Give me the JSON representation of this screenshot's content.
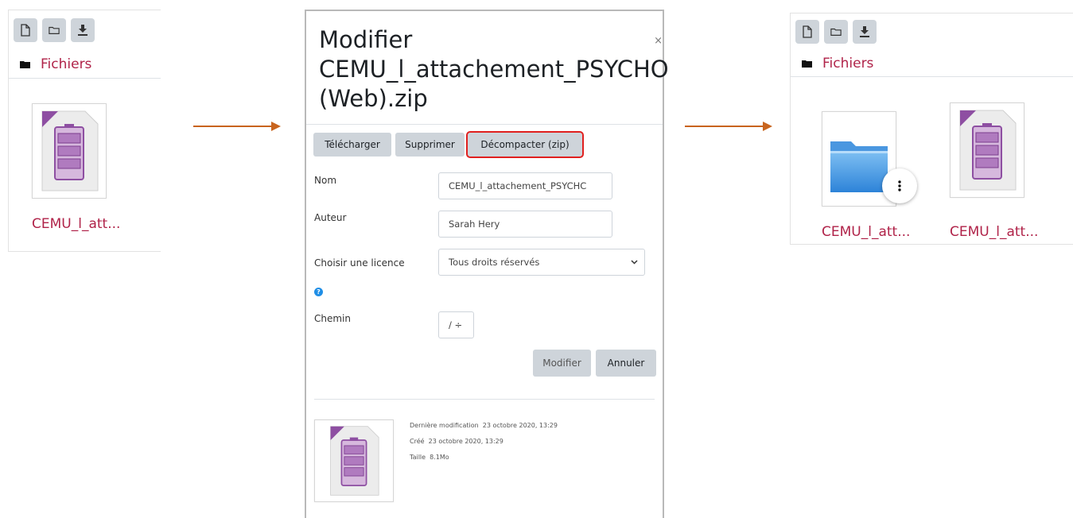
{
  "left_panel": {
    "toolbar": [
      {
        "icon": "new-file-icon"
      },
      {
        "icon": "new-folder-icon"
      },
      {
        "icon": "download-icon"
      }
    ],
    "breadcrumb": "Fichiers",
    "files": [
      {
        "name": "CEMU_l_att...",
        "icon": "zip-archive-icon"
      }
    ]
  },
  "dialog": {
    "title": "Modifier CEMU_l_attachement_PSYCHO (Web).zip",
    "close_glyph": "×",
    "buttons": {
      "download": "Télécharger",
      "delete": "Supprimer",
      "unzip": "Décompacter (zip)",
      "update": "Modifier",
      "cancel": "Annuler"
    },
    "fields": {
      "name_label": "Nom",
      "name_value": "CEMU_l_attachement_PSYCHC",
      "author_label": "Auteur",
      "author_value": "Sarah Hery",
      "license_label": "Choisir une licence",
      "license_value": "Tous droits réservés",
      "path_label": "Chemin",
      "path_value": "/ ÷"
    },
    "file_info": {
      "modified_label": "Dernière modification",
      "modified_value": "23 octobre 2020, 13:29",
      "created_label": "Créé",
      "created_value": "23 octobre 2020, 13:29",
      "size_label": "Taille",
      "size_value": "8.1Mo"
    }
  },
  "right_panel": {
    "toolbar": [
      {
        "icon": "new-file-icon"
      },
      {
        "icon": "new-folder-icon"
      },
      {
        "icon": "download-icon"
      }
    ],
    "breadcrumb": "Fichiers",
    "files": [
      {
        "name": "CEMU_l_att...",
        "icon": "folder-icon"
      },
      {
        "name": "CEMU_l_att...",
        "icon": "zip-archive-icon"
      }
    ]
  },
  "colors": {
    "arrow": "#c8641e",
    "link": "#b02349",
    "highlight": "#e0201f",
    "button": "#ced4da"
  }
}
